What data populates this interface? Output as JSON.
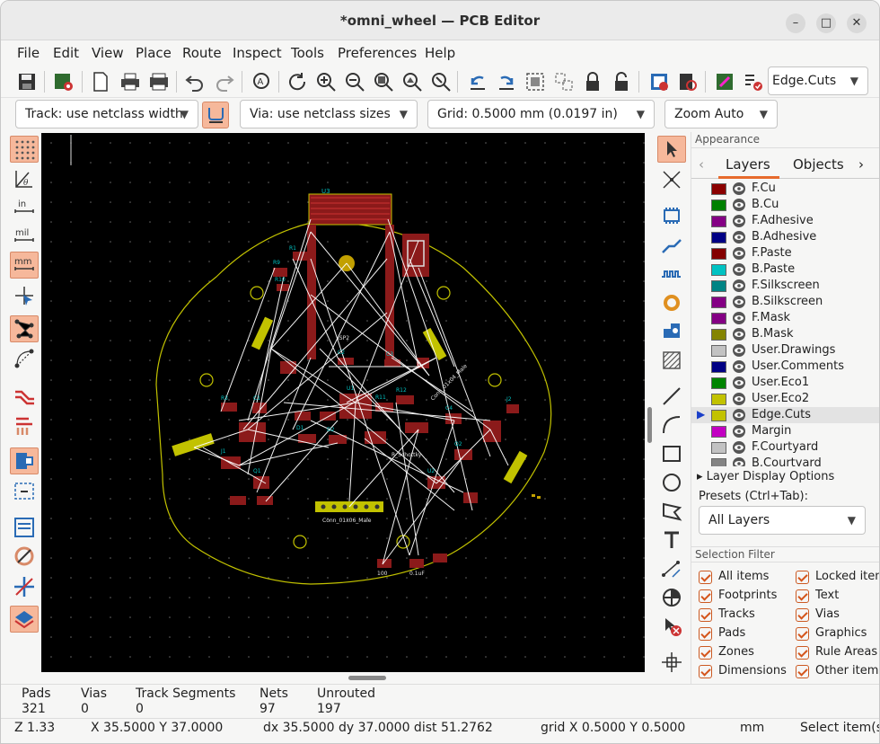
{
  "window": {
    "title": "*omni_wheel — PCB Editor",
    "minimize": "–",
    "maximize": "□",
    "close": "✕"
  },
  "menu": [
    "File",
    "Edit",
    "View",
    "Place",
    "Route",
    "Inspect",
    "Tools",
    "Preferences",
    "Help"
  ],
  "toolbar": {
    "layer_select": "Edge.Cuts"
  },
  "toolbar2": {
    "track": "Track: use netclass width",
    "via": "Via: use netclass sizes",
    "grid": "Grid: 0.5000 mm (0.0197 in)",
    "zoom": "Zoom Auto"
  },
  "left_tools": [
    "grid-dots",
    "polar",
    "inches",
    "mils",
    "millimeters",
    "cursor-crosshair",
    "ratsnest",
    "curved-ratsnest",
    "track-highlight",
    "net-highlight",
    "pad-display",
    "via-display",
    "track-display",
    "zone-display",
    "layer-stack"
  ],
  "right_tools": [
    "select",
    "local-ratsnest",
    "footprint",
    "route-track",
    "route-diff-pair",
    "tune-length",
    "via",
    "zone",
    "rule-area",
    "line",
    "arc",
    "rectangle",
    "circle",
    "polygon",
    "text",
    "dimension",
    "reference-origin",
    "delete",
    "grid-origin"
  ],
  "appearance": {
    "header": "Appearance",
    "tabs": [
      "Layers",
      "Objects"
    ],
    "layers": [
      {
        "name": "F.Cu",
        "color": "#8b0000"
      },
      {
        "name": "B.Cu",
        "color": "#008000"
      },
      {
        "name": "F.Adhesive",
        "color": "#840084"
      },
      {
        "name": "B.Adhesive",
        "color": "#000084"
      },
      {
        "name": "F.Paste",
        "color": "#840000"
      },
      {
        "name": "B.Paste",
        "color": "#00c2c2"
      },
      {
        "name": "F.Silkscreen",
        "color": "#008484"
      },
      {
        "name": "B.Silkscreen",
        "color": "#840084"
      },
      {
        "name": "F.Mask",
        "color": "#840084"
      },
      {
        "name": "B.Mask",
        "color": "#848400"
      },
      {
        "name": "User.Drawings",
        "color": "#c2c2c2"
      },
      {
        "name": "User.Comments",
        "color": "#000084"
      },
      {
        "name": "User.Eco1",
        "color": "#008400"
      },
      {
        "name": "User.Eco2",
        "color": "#c2c200"
      },
      {
        "name": "Edge.Cuts",
        "color": "#c2c200"
      },
      {
        "name": "Margin",
        "color": "#c200c2"
      },
      {
        "name": "F.Courtyard",
        "color": "#c2c2c2"
      },
      {
        "name": "B.Courtyard",
        "color": "#848484"
      }
    ],
    "active_layer": "Edge.Cuts",
    "layer_display_options": "Layer Display Options",
    "presets_label": "Presets (Ctrl+Tab):",
    "preset_value": "All Layers"
  },
  "selection_filter": {
    "header": "Selection Filter",
    "left": [
      "All items",
      "Footprints",
      "Tracks",
      "Pads",
      "Zones",
      "Dimensions"
    ],
    "right": [
      "Locked items",
      "Text",
      "Vias",
      "Graphics",
      "Rule Areas",
      "Other items"
    ]
  },
  "board": {
    "silk": [
      "U3",
      "ISP2",
      "Conn_01x06_Male",
      "Conn_01x04_Male",
      "R_Schottky",
      "100",
      "0.1uF",
      "R1",
      "R3",
      "C1",
      "C2",
      "C3",
      "C4",
      "D1",
      "D2",
      "R9",
      "R10",
      "R11",
      "R12",
      "Q1",
      "Q2",
      "U1",
      "U2",
      "J1",
      "J2"
    ]
  },
  "stats": [
    {
      "label": "Pads",
      "value": "321"
    },
    {
      "label": "Vias",
      "value": "0"
    },
    {
      "label": "Track Segments",
      "value": "0"
    },
    {
      "label": "Nets",
      "value": "97"
    },
    {
      "label": "Unrouted",
      "value": "197"
    }
  ],
  "status": {
    "zoom": "Z 1.33",
    "xy": "X 35.5000  Y 37.0000",
    "delta": "dx 35.5000  dy 37.0000  dist 51.2762",
    "grid": "grid X 0.5000  Y 0.5000",
    "units": "mm",
    "mode": "Select item(s)"
  }
}
